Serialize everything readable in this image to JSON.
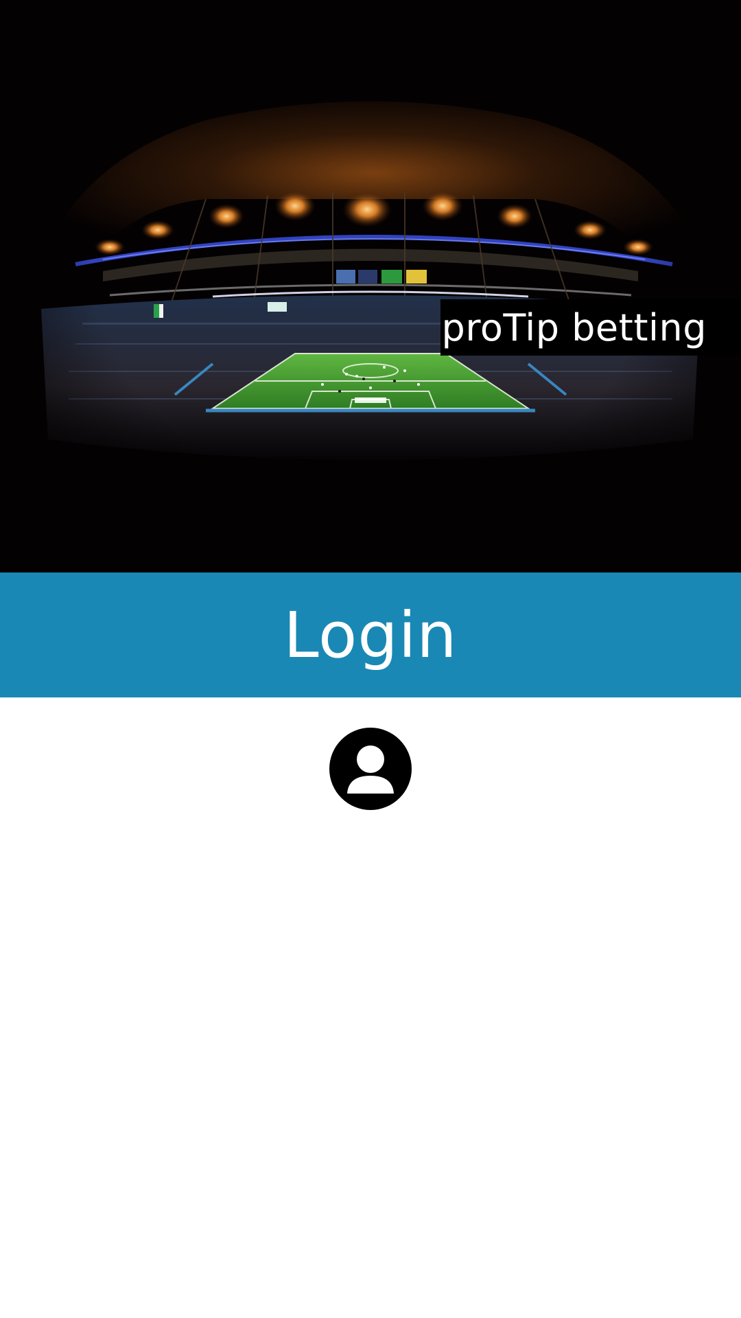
{
  "brand": {
    "name": "proTip betting"
  },
  "hero": {
    "image_icon": "stadium-illustration"
  },
  "login": {
    "title": "Login",
    "avatar_icon": "user-icon"
  },
  "colors": {
    "login_bar": "#1A88B4",
    "hero_background": "#040102",
    "brand_box": "#000000"
  }
}
